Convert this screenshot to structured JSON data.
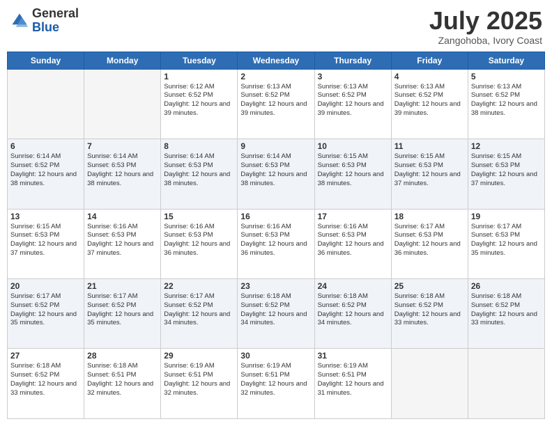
{
  "header": {
    "logo_general": "General",
    "logo_blue": "Blue",
    "title": "July 2025",
    "location": "Zangohoba, Ivory Coast"
  },
  "days_of_week": [
    "Sunday",
    "Monday",
    "Tuesday",
    "Wednesday",
    "Thursday",
    "Friday",
    "Saturday"
  ],
  "weeks": [
    [
      {
        "day": "",
        "info": ""
      },
      {
        "day": "",
        "info": ""
      },
      {
        "day": "1",
        "info": "Sunrise: 6:12 AM\nSunset: 6:52 PM\nDaylight: 12 hours and 39 minutes."
      },
      {
        "day": "2",
        "info": "Sunrise: 6:13 AM\nSunset: 6:52 PM\nDaylight: 12 hours and 39 minutes."
      },
      {
        "day": "3",
        "info": "Sunrise: 6:13 AM\nSunset: 6:52 PM\nDaylight: 12 hours and 39 minutes."
      },
      {
        "day": "4",
        "info": "Sunrise: 6:13 AM\nSunset: 6:52 PM\nDaylight: 12 hours and 39 minutes."
      },
      {
        "day": "5",
        "info": "Sunrise: 6:13 AM\nSunset: 6:52 PM\nDaylight: 12 hours and 38 minutes."
      }
    ],
    [
      {
        "day": "6",
        "info": "Sunrise: 6:14 AM\nSunset: 6:52 PM\nDaylight: 12 hours and 38 minutes."
      },
      {
        "day": "7",
        "info": "Sunrise: 6:14 AM\nSunset: 6:53 PM\nDaylight: 12 hours and 38 minutes."
      },
      {
        "day": "8",
        "info": "Sunrise: 6:14 AM\nSunset: 6:53 PM\nDaylight: 12 hours and 38 minutes."
      },
      {
        "day": "9",
        "info": "Sunrise: 6:14 AM\nSunset: 6:53 PM\nDaylight: 12 hours and 38 minutes."
      },
      {
        "day": "10",
        "info": "Sunrise: 6:15 AM\nSunset: 6:53 PM\nDaylight: 12 hours and 38 minutes."
      },
      {
        "day": "11",
        "info": "Sunrise: 6:15 AM\nSunset: 6:53 PM\nDaylight: 12 hours and 37 minutes."
      },
      {
        "day": "12",
        "info": "Sunrise: 6:15 AM\nSunset: 6:53 PM\nDaylight: 12 hours and 37 minutes."
      }
    ],
    [
      {
        "day": "13",
        "info": "Sunrise: 6:15 AM\nSunset: 6:53 PM\nDaylight: 12 hours and 37 minutes."
      },
      {
        "day": "14",
        "info": "Sunrise: 6:16 AM\nSunset: 6:53 PM\nDaylight: 12 hours and 37 minutes."
      },
      {
        "day": "15",
        "info": "Sunrise: 6:16 AM\nSunset: 6:53 PM\nDaylight: 12 hours and 36 minutes."
      },
      {
        "day": "16",
        "info": "Sunrise: 6:16 AM\nSunset: 6:53 PM\nDaylight: 12 hours and 36 minutes."
      },
      {
        "day": "17",
        "info": "Sunrise: 6:16 AM\nSunset: 6:53 PM\nDaylight: 12 hours and 36 minutes."
      },
      {
        "day": "18",
        "info": "Sunrise: 6:17 AM\nSunset: 6:53 PM\nDaylight: 12 hours and 36 minutes."
      },
      {
        "day": "19",
        "info": "Sunrise: 6:17 AM\nSunset: 6:53 PM\nDaylight: 12 hours and 35 minutes."
      }
    ],
    [
      {
        "day": "20",
        "info": "Sunrise: 6:17 AM\nSunset: 6:52 PM\nDaylight: 12 hours and 35 minutes."
      },
      {
        "day": "21",
        "info": "Sunrise: 6:17 AM\nSunset: 6:52 PM\nDaylight: 12 hours and 35 minutes."
      },
      {
        "day": "22",
        "info": "Sunrise: 6:17 AM\nSunset: 6:52 PM\nDaylight: 12 hours and 34 minutes."
      },
      {
        "day": "23",
        "info": "Sunrise: 6:18 AM\nSunset: 6:52 PM\nDaylight: 12 hours and 34 minutes."
      },
      {
        "day": "24",
        "info": "Sunrise: 6:18 AM\nSunset: 6:52 PM\nDaylight: 12 hours and 34 minutes."
      },
      {
        "day": "25",
        "info": "Sunrise: 6:18 AM\nSunset: 6:52 PM\nDaylight: 12 hours and 33 minutes."
      },
      {
        "day": "26",
        "info": "Sunrise: 6:18 AM\nSunset: 6:52 PM\nDaylight: 12 hours and 33 minutes."
      }
    ],
    [
      {
        "day": "27",
        "info": "Sunrise: 6:18 AM\nSunset: 6:52 PM\nDaylight: 12 hours and 33 minutes."
      },
      {
        "day": "28",
        "info": "Sunrise: 6:18 AM\nSunset: 6:51 PM\nDaylight: 12 hours and 32 minutes."
      },
      {
        "day": "29",
        "info": "Sunrise: 6:19 AM\nSunset: 6:51 PM\nDaylight: 12 hours and 32 minutes."
      },
      {
        "day": "30",
        "info": "Sunrise: 6:19 AM\nSunset: 6:51 PM\nDaylight: 12 hours and 32 minutes."
      },
      {
        "day": "31",
        "info": "Sunrise: 6:19 AM\nSunset: 6:51 PM\nDaylight: 12 hours and 31 minutes."
      },
      {
        "day": "",
        "info": ""
      },
      {
        "day": "",
        "info": ""
      }
    ]
  ]
}
